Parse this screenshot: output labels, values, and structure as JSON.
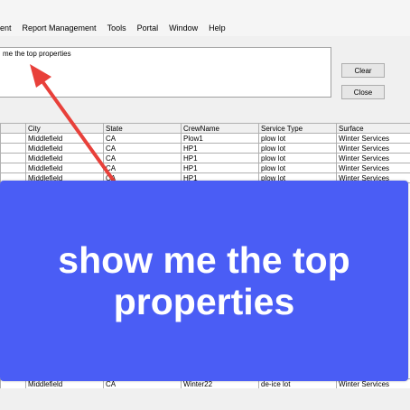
{
  "menu": {
    "items": [
      {
        "label": "ent"
      },
      {
        "label": "Report Management"
      },
      {
        "label": "Tools"
      },
      {
        "label": "Portal"
      },
      {
        "label": "Window"
      },
      {
        "label": "Help"
      }
    ]
  },
  "query": {
    "text": "me the top properties"
  },
  "buttons": {
    "clear": "Clear",
    "close": "Close"
  },
  "table": {
    "headers": [
      "",
      "City",
      "State",
      "CrewName",
      "Service Type",
      "Surface"
    ],
    "rows": [
      [
        "",
        "Middlefield",
        "CA",
        "Plow1",
        "plow lot",
        "Winter Services"
      ],
      [
        "",
        "Middlefield",
        "CA",
        "HP1",
        "plow lot",
        "Winter Services"
      ],
      [
        "",
        "Middlefield",
        "CA",
        "HP1",
        "plow lot",
        "Winter Services"
      ],
      [
        "",
        "Middlefield",
        "CA",
        "HP1",
        "plow lot",
        "Winter Services"
      ],
      [
        "",
        "Middlefield",
        "CA",
        "HP1",
        "plow lot",
        "Winter Services"
      ]
    ],
    "last_row": [
      "",
      "Middlefield",
      "CA",
      "Winter22",
      "de-ice lot",
      "Winter Services"
    ]
  },
  "overlay": {
    "caption": "show me the top properties"
  },
  "colors": {
    "overlay": "#4a5df5",
    "arrow": "#e8403a"
  }
}
